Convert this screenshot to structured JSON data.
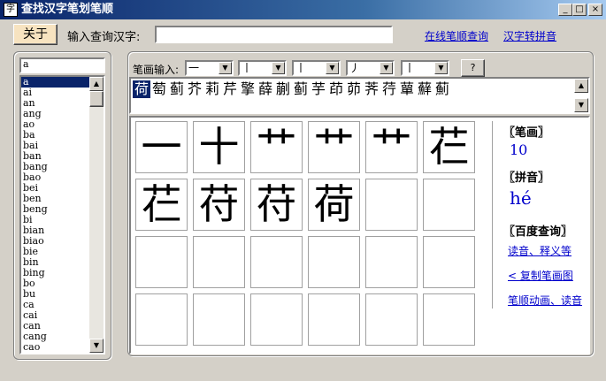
{
  "window": {
    "title": "查找汉字笔划笔顺",
    "icon_glyph": "字",
    "buttons": {
      "minimize": "_",
      "maximize": "□",
      "close": "×"
    }
  },
  "toolbar": {
    "about_label": "关于",
    "input_label": "输入查询汉字:",
    "input_value": "",
    "link_online": "在线笔顺查询",
    "link_pinyin": "汉字转拼音"
  },
  "sidebar": {
    "search_value": "a",
    "pinyin_list": [
      "a",
      "ai",
      "an",
      "ang",
      "ao",
      "ba",
      "bai",
      "ban",
      "bang",
      "bao",
      "bei",
      "ben",
      "beng",
      "bi",
      "bian",
      "biao",
      "bie",
      "bin",
      "bing",
      "bo",
      "bu",
      "ca",
      "cai",
      "can",
      "cang",
      "cao"
    ],
    "selected_index": 0
  },
  "stroke_input": {
    "label": "笔画输入:",
    "combos": [
      "一",
      "丨",
      "丨",
      "丿",
      "丨"
    ],
    "query_button": "?"
  },
  "results": {
    "chars": [
      "荷",
      "萄",
      "蓟",
      "芥",
      "莉",
      "芹",
      "擎",
      "薛",
      "蒯",
      "蓟",
      "芋",
      "茚",
      "茆",
      "荠",
      "荇",
      "蕇",
      "蘚",
      "薊"
    ],
    "selected_index": 0
  },
  "stroke_order": {
    "steps": [
      "一",
      "十",
      "艹",
      "艹",
      "艹",
      "芢",
      "芢",
      "苻",
      "苻",
      "荷"
    ]
  },
  "info": {
    "strokes_label": "〖笔画〗",
    "strokes_value": "10",
    "pinyin_label": "〖拼音〗",
    "pinyin_value": "hé",
    "baidu_label": "〖百度查询〗",
    "link_read": "读音、释义等",
    "link_copy": "< 复制笔画图",
    "link_anim": "笔顺动画、读音"
  },
  "colors": {
    "accent": "#0a246a",
    "link": "#0000cc",
    "face": "#d4d0c8"
  }
}
